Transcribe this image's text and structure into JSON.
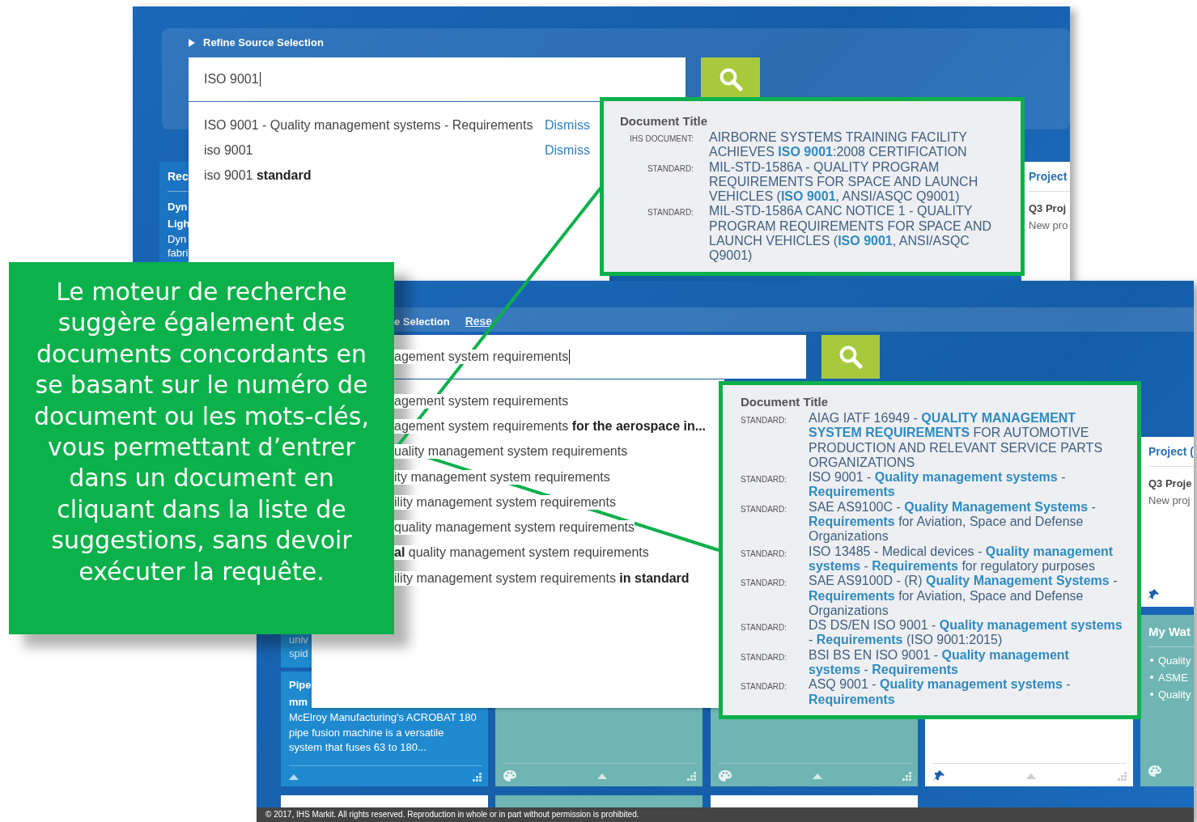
{
  "screenshots": [
    {
      "refine_label": "Refine Source Selection",
      "search_value": "ISO 9001",
      "suggestions": [
        {
          "text": "ISO 9001 - Quality management systems - Requirements",
          "action": "Dismiss"
        },
        {
          "text": "iso 9001",
          "action": "Dismiss"
        },
        {
          "text": "iso 9001 **standard**"
        }
      ],
      "popup": {
        "heading": "Document Title",
        "results": [
          {
            "type": "IHS DOCUMENT:",
            "title": "AIRBORNE SYSTEMS TRAINING FACILITY ACHIEVES **ISO 9001**:2008 CERTIFICATION"
          },
          {
            "type": "STANDARD:",
            "title": "MIL-STD-1586A - QUALITY PROGRAM REQUIREMENTS FOR SPACE AND LAUNCH VEHICLES (**ISO 9001**, ANSI/ASQC Q9001)"
          },
          {
            "type": "STANDARD:",
            "title": "MIL-STD-1586A CANC NOTICE 1 - QUALITY PROGRAM REQUIREMENTS FOR SPACE AND LAUNCH VEHICLES (**ISO 9001**, ANSI/ASQC Q9001)"
          }
        ]
      },
      "left_tile": {
        "heading": "Rec",
        "title_lines": [
          "Dyn",
          "Ligh"
        ],
        "text_lines": [
          "Dyn",
          "fabri"
        ]
      },
      "right_card": {
        "heading": "Project",
        "title": "Q3 Proj",
        "text": "New pro"
      }
    },
    {
      "refine_label": "e Selection",
      "reset_link": "Rese",
      "search_value": "agement system requirements",
      "suggestions": [
        {
          "text": "agement system requirements"
        },
        {
          "text": "agement system requirements **for the aerospace in...**"
        },
        {
          "text": "uality management system requirements"
        },
        {
          "text": "ity management system requirements"
        },
        {
          "text": "ility management system requirements"
        },
        {
          "text": "quality management system requirements"
        },
        {
          "text": "**al** quality management system requirements"
        },
        {
          "text": "ility management system requirements **in standard**"
        }
      ],
      "popup": {
        "heading": "Document Title",
        "results": [
          {
            "type": "STANDARD:",
            "title": "AIAG IATF 16949 - **QUALITY MANAGEMENT SYSTEM REQUIREMENTS** FOR AUTOMOTIVE PRODUCTION AND RELEVANT SERVICE PARTS ORGANIZATIONS"
          },
          {
            "type": "STANDARD:",
            "title": "ISO 9001 - **Quality management systems** - **Requirements**"
          },
          {
            "type": "STANDARD:",
            "title": "SAE AS9100C - **Quality Management Systems** - **Requirements** for Aviation, Space and Defense Organizations"
          },
          {
            "type": "STANDARD:",
            "title": "ISO 13485 - Medical devices - **Quality management systems** - **Requirements** for regulatory purposes"
          },
          {
            "type": "STANDARD:",
            "title": "SAE AS9100D - (R) **Quality Management Systems** - **Requirements** for Aviation, Space and Defense Organizations"
          },
          {
            "type": "STANDARD:",
            "title": "DS DS/EN ISO 9001 - **Quality management systems** - **Requirements** (ISO 9001:2015)"
          },
          {
            "type": "STANDARD:",
            "title": "BSI BS EN ISO 9001 - **Quality management systems** - **Requirements**"
          },
          {
            "type": "STANDARD:",
            "title": "ASQ 9001 - **Quality management systems** - **Requirements**"
          }
        ]
      },
      "left_tile": {
        "text_lines": [
          "univ",
          "spid"
        ]
      },
      "pipe_tile": {
        "title_lines": [
          "Pipe",
          "mm"
        ],
        "text": "McElroy Manufacturing's ACROBAT 180 pipe fusion machine is a versatile system that fuses 63 to 180..."
      },
      "right_card": {
        "heading": "Project (",
        "title": "Q3 Proje",
        "text": "New proj"
      },
      "watch_tile": {
        "heading": "My Wat",
        "items": [
          "Quality",
          "ASME",
          "Quality"
        ]
      },
      "footer": "© 2017, IHS Markit. All rights reserved. Reproduction in whole or in part without permission is prohibited."
    }
  ],
  "callout": {
    "text": "Le moteur de recherche suggère également des documents concordants en se basant sur le numéro de document ou les mots-clés, vous permettant d’entrer dans un document en cliquant dans la liste de suggestions, sans devoir exécuter la requête."
  }
}
